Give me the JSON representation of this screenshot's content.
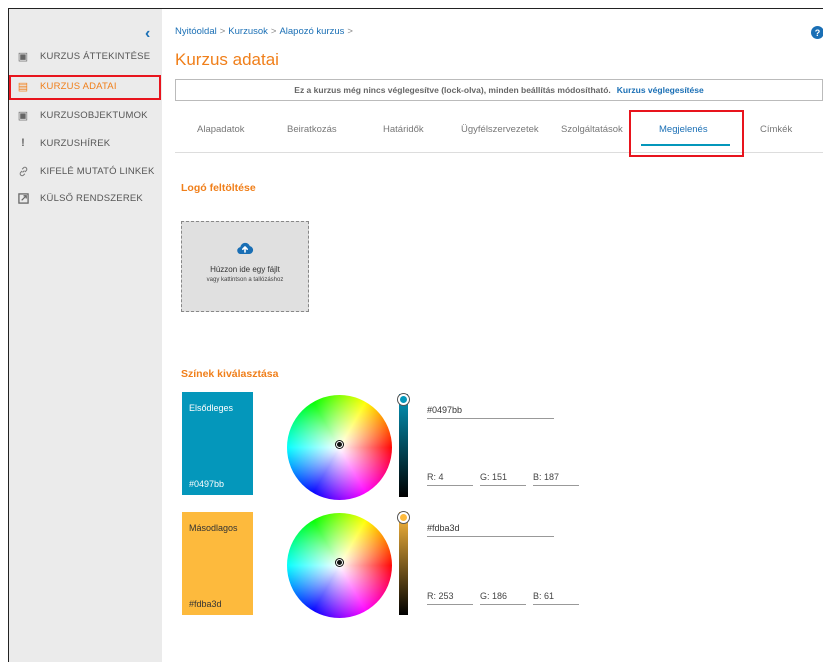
{
  "sidebar": {
    "collapse_icon": "chevron-left-icon",
    "items": [
      {
        "label": "KURZUS ÁTTEKINTÉSE",
        "icon": "overview-icon",
        "active": false
      },
      {
        "label": "KURZUS ADATAI",
        "icon": "data-icon",
        "active": true
      },
      {
        "label": "KURZUSOBJEKTUMOK",
        "icon": "objects-icon",
        "active": false
      },
      {
        "label": "KURZUSHÍREK",
        "icon": "exclamation-icon",
        "active": false
      },
      {
        "label": "KIFELÉ MUTATÓ LINKEK",
        "icon": "link-icon",
        "active": false
      },
      {
        "label": "KÜLSŐ RENDSZEREK",
        "icon": "external-icon",
        "active": false
      }
    ]
  },
  "breadcrumb": {
    "items": [
      "Nyitóoldal",
      "Kurzusok",
      "Alapozó kurzus"
    ],
    "separator": ">"
  },
  "help_label": "?",
  "page_title": "Kurzus adatai",
  "notice": {
    "text": "Ez a kurzus még nincs véglegesítve (lock-olva), minden beállítás módosítható.",
    "link": "Kurzus véglegesítése"
  },
  "tabs": [
    {
      "label": "Alapadatok"
    },
    {
      "label": "Beiratkozás"
    },
    {
      "label": "Határidők"
    },
    {
      "label": "Ügyfélszervezetek"
    },
    {
      "label": "Szolgáltatások"
    },
    {
      "label": "Megjelenés",
      "active": true
    },
    {
      "label": "Címkék"
    }
  ],
  "logo": {
    "title": "Logó feltöltése",
    "drop_main": "Húzzon ide egy fájlt",
    "drop_sub": "vagy kattintson a tallózáshoz",
    "icon": "cloud-upload-icon"
  },
  "colors": {
    "title": "Színek kiválasztása",
    "primary": {
      "name": "Elsődleges",
      "hex": "#0497bb",
      "r_label": "R: 4",
      "g_label": "G: 151",
      "b_label": "B: 187",
      "slider_colors": [
        "#0497bb",
        "#000000"
      ]
    },
    "secondary": {
      "name": "Másodlagos",
      "hex": "#fdba3d",
      "r_label": "R: 253",
      "g_label": "G: 186",
      "b_label": "B: 61",
      "slider_colors": [
        "#fdba3d",
        "#000000"
      ]
    }
  },
  "theme": {
    "accent": "#f07f1a",
    "link": "#1a6fb5",
    "highlight": "#e8141d"
  }
}
